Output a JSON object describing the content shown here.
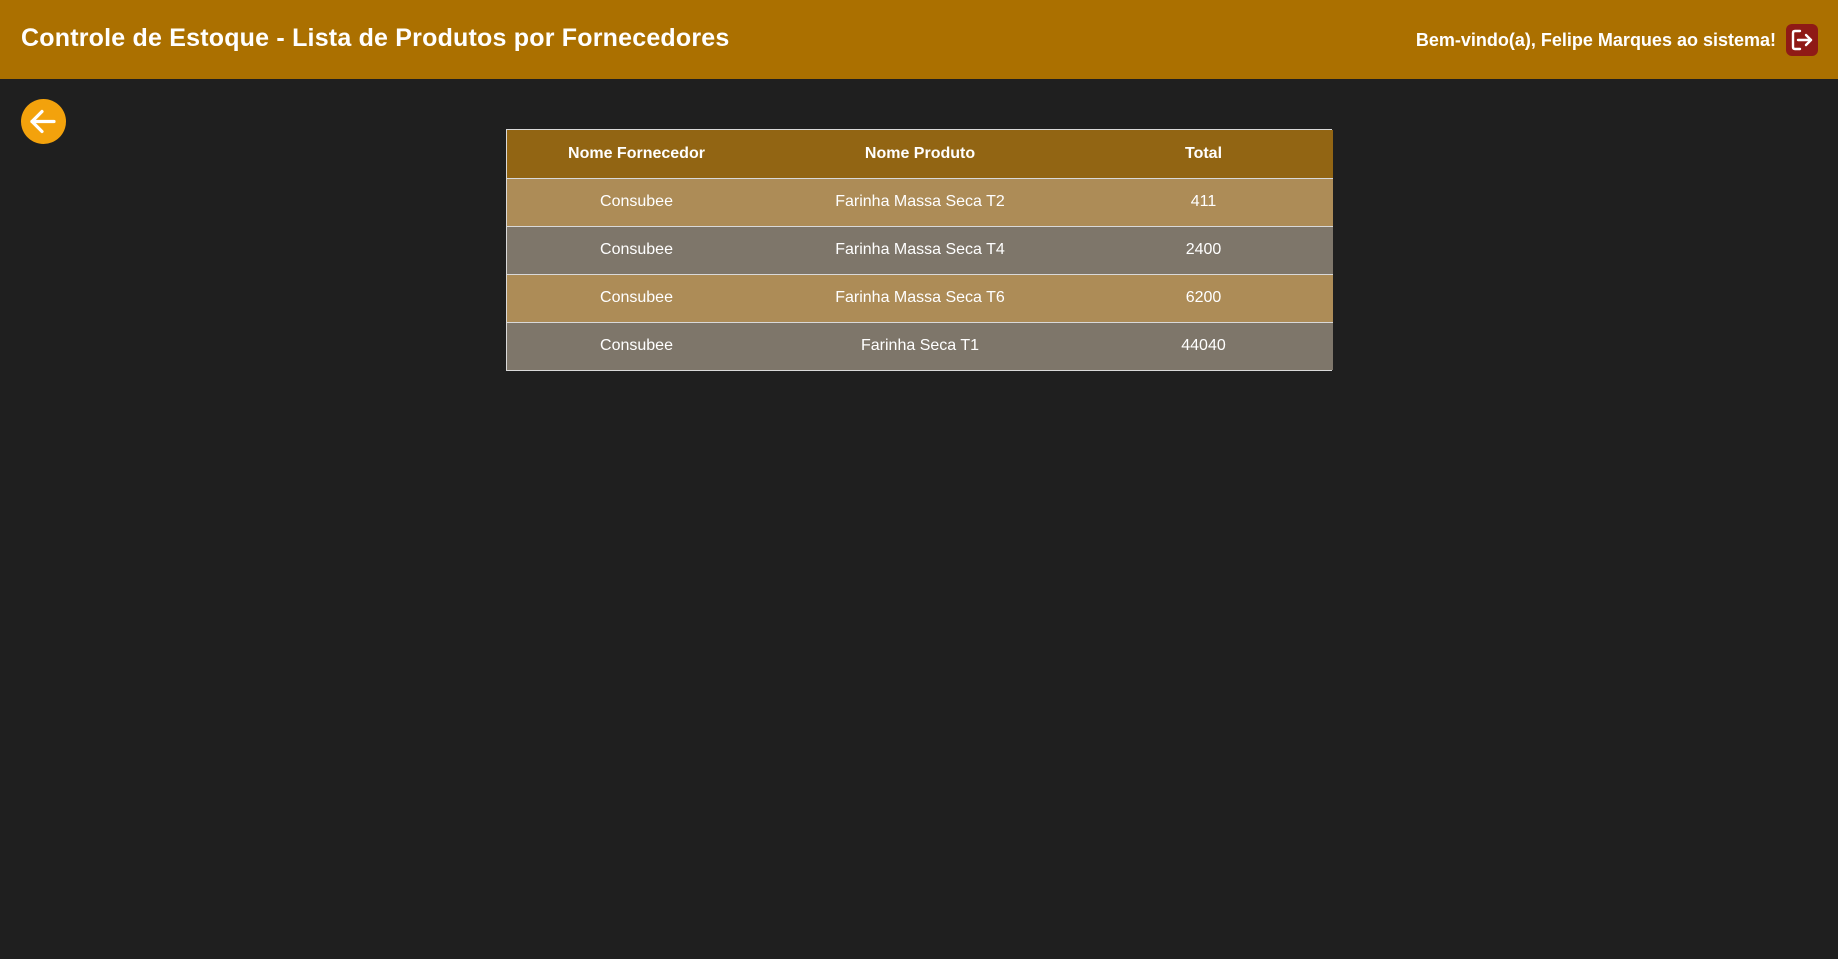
{
  "header": {
    "title": "Controle de Estoque - Lista de Produtos por Fornecedores",
    "welcome": "Bem-vindo(a), Felipe Marques ao sistema!",
    "logout_icon": "logout-icon"
  },
  "back_icon": "arrow-left-icon",
  "colors": {
    "header_bg": "#ab7000",
    "page_bg": "#1f1f1f",
    "back_button": "#f3a20c",
    "logout_button": "#8f1a16",
    "table_header": "#926513",
    "row_odd": "#ad8c57",
    "row_even": "#7e766a"
  },
  "table": {
    "columns": [
      "Nome Fornecedor",
      "Nome Produto",
      "Total"
    ],
    "rows": [
      [
        "Consubee",
        "Farinha Massa Seca T2",
        "411"
      ],
      [
        "Consubee",
        "Farinha Massa Seca T4",
        "2400"
      ],
      [
        "Consubee",
        "Farinha Massa Seca T6",
        "6200"
      ],
      [
        "Consubee",
        "Farinha Seca T1",
        "44040"
      ]
    ]
  }
}
